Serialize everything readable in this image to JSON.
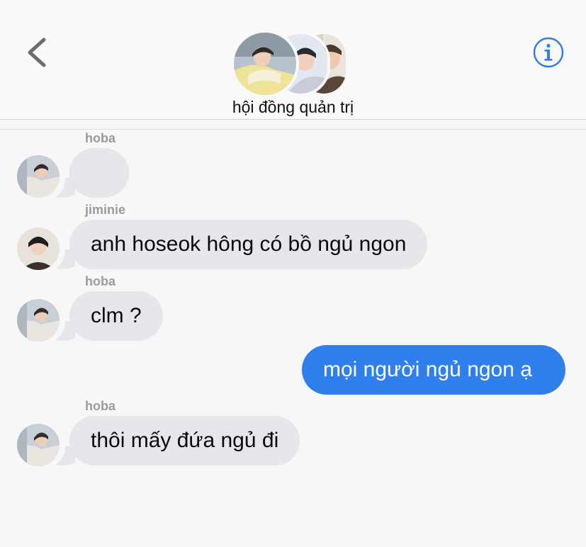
{
  "header": {
    "group_name": "hội đồng quản trị"
  },
  "messages": [
    {
      "sender": "hoba",
      "text": "",
      "direction": "incoming"
    },
    {
      "sender": "jiminie",
      "text": "anh hoseok hông có bồ ngủ ngon",
      "direction": "incoming"
    },
    {
      "sender": "hoba",
      "text": "clm ?",
      "direction": "incoming"
    },
    {
      "sender": "",
      "text": "mọi người ngủ ngon ạ",
      "direction": "outgoing"
    },
    {
      "sender": "hoba",
      "text": "thôi mấy đứa ngủ đi",
      "direction": "incoming"
    }
  ],
  "colors": {
    "accent": "#2f80ed",
    "incoming_bubble": "#e6e6eb",
    "background": "#f7f7f8",
    "sender_label": "#9a9aa0"
  },
  "icons": {
    "back": "chevron-left-icon",
    "info": "info-circle-icon"
  }
}
